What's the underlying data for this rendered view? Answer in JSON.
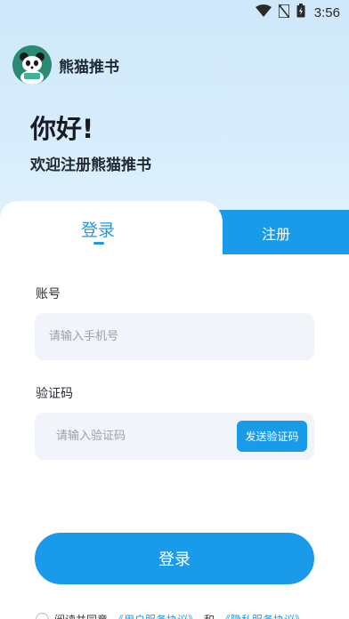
{
  "status_bar": {
    "time": "3:56"
  },
  "brand": {
    "name": "熊猫推书",
    "logo_icon": "panda-logo-icon"
  },
  "hero": {
    "greeting": "你好!",
    "subtitle": "欢迎注册熊猫推书"
  },
  "tabs": {
    "login": "登录",
    "register": "注册"
  },
  "form": {
    "account_label": "账号",
    "account_placeholder": "请输入手机号",
    "code_label": "验证码",
    "code_placeholder": "请输入验证码",
    "send_code": "发送验证码"
  },
  "login_button": "登录",
  "agreement": {
    "prefix": "阅读并同意",
    "user_terms": "《用户服务协议》",
    "and": "和",
    "privacy_terms": "《隐私服务协议》"
  },
  "colors": {
    "accent": "#1a9bea",
    "hero_bg": "#d6ecfb",
    "input_bg": "#f1f4f8"
  }
}
